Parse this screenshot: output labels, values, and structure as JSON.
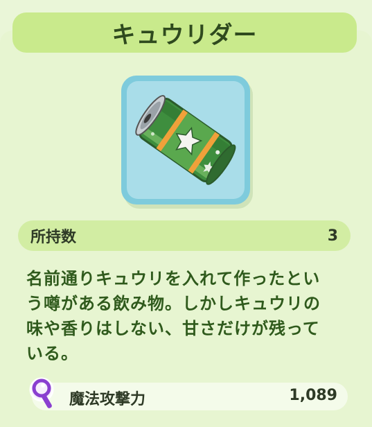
{
  "header": {
    "title": "キュウリダー"
  },
  "item": {
    "icon": "green-can-icon"
  },
  "owned": {
    "label": "所持数",
    "value": "3"
  },
  "description": {
    "lines": [
      "名前通りキュウリを入れて作ったとい",
      "う噂がある飲み物。しかしキュウリの",
      "味や香りはしない、甘さだけが残って",
      "いる。"
    ]
  },
  "stat": {
    "icon": "magic-wand-icon",
    "label": "魔法攻撃力",
    "value": "1,089"
  },
  "colors": {
    "accent": "#c9ea8c",
    "text": "#2f5a1c",
    "frame": "#7ecbdc"
  }
}
